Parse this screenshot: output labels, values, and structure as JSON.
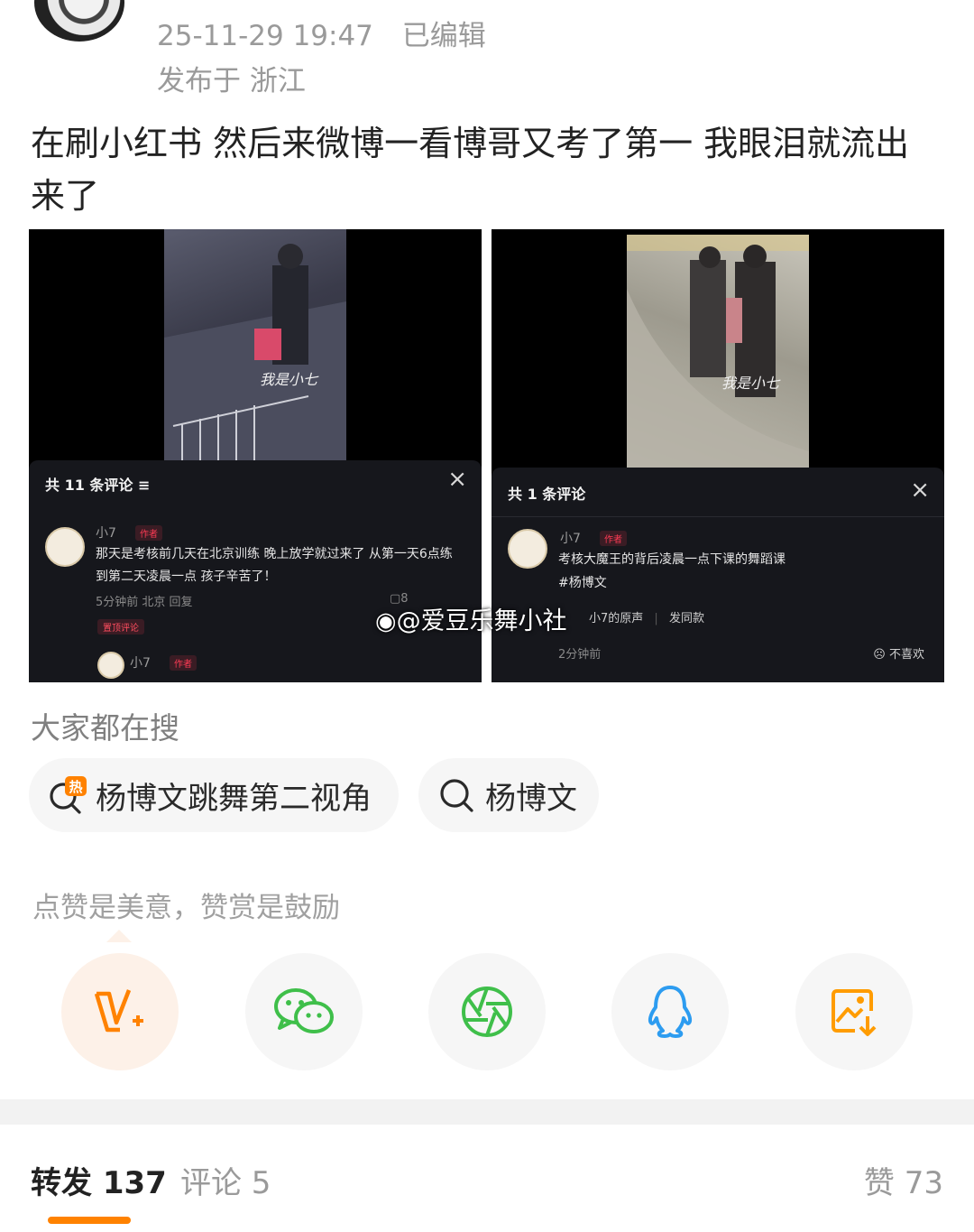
{
  "post": {
    "timestamp": "25-11-29 19:47",
    "edited_label": "已编辑",
    "location": "发布于 浙江",
    "text": "在刷小红书 然后来微博一看博哥又考了第一 我眼泪就流出来了"
  },
  "images": [
    {
      "comment_header": "共 11 条评论 ≡",
      "video_signature": "我是小七",
      "comments": [
        {
          "name": "小7",
          "badge": "作者",
          "text": "那天是考核前几天在北京训练 晚上放学就过来了 从第一天6点练到第二天凌晨一点 孩子辛苦了！",
          "meta": "5分钟前 北京  回复",
          "reply_count": "8",
          "pinned": "置顶评论"
        },
        {
          "name": "小7",
          "badge": "作者"
        }
      ]
    },
    {
      "comment_header": "共 1 条评论",
      "video_signature": "我是小七",
      "comments": [
        {
          "name": "小7",
          "badge": "作者",
          "text": "考核大魔王的背后凌晨一点下课的舞蹈课",
          "hashtag": "#杨博文",
          "audio": "小7的原声",
          "audio_action": "发同款",
          "meta": "2分钟前",
          "dislike": "不喜欢"
        }
      ]
    }
  ],
  "watermark": "@爱豆乐舞小社",
  "search": {
    "title": "大家都在搜",
    "chips": [
      {
        "label": "杨博文跳舞第二视角",
        "icon": "hot-search-icon",
        "hot_mark": "热"
      },
      {
        "label": "杨博文",
        "icon": "search-icon"
      }
    ]
  },
  "reward": {
    "prompt": "点赞是美意，赞赏是鼓励",
    "share_buttons": [
      {
        "icon": "reward-v-plus-icon",
        "color": "#ff8200"
      },
      {
        "icon": "wechat-icon",
        "color": "#3fbf4a"
      },
      {
        "icon": "moments-icon",
        "color": "#3fbf4a"
      },
      {
        "icon": "qq-icon",
        "color": "#2d9cf0"
      },
      {
        "icon": "save-image-icon",
        "color": "#ff9c00"
      }
    ]
  },
  "tabs": {
    "repost": "转发 137",
    "comment": "评论 5",
    "like": "赞 73"
  },
  "colors": {
    "accent": "#ff8200",
    "meta_gray": "#9a9a9a",
    "chip_bg": "#f6f6f6"
  }
}
